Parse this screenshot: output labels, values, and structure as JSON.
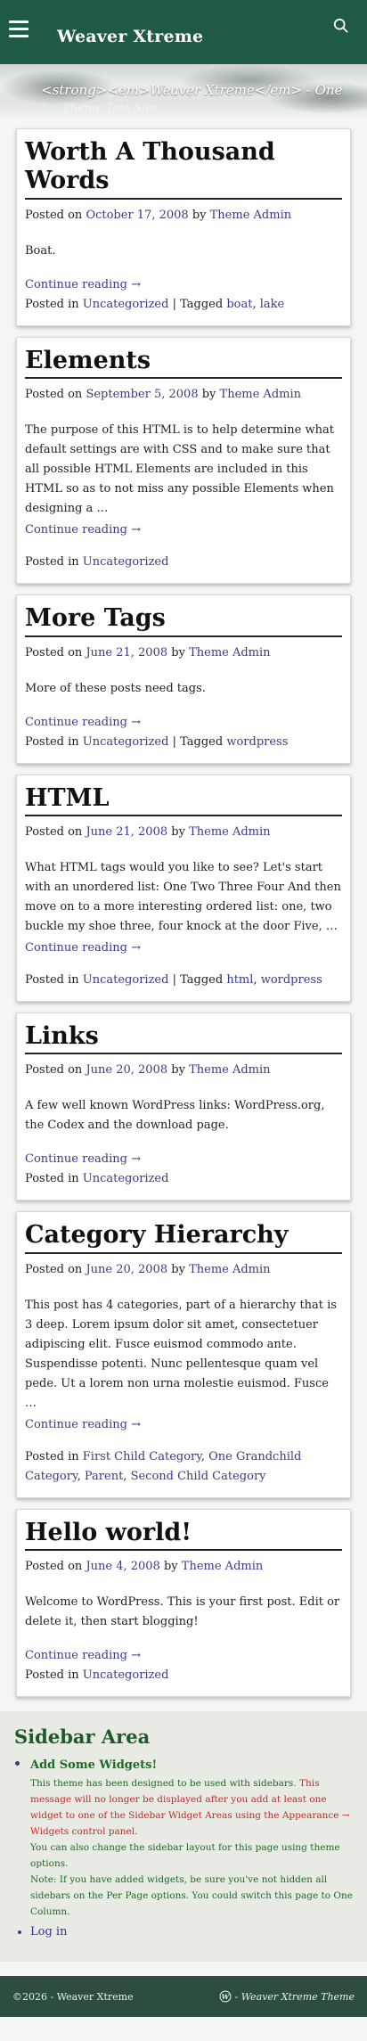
{
  "header": {
    "site_title": "Weaver Xtreme",
    "tagline": "<strong><em>Weaver Xtreme</em> - One",
    "tagline_ghost": "Theme Test Site"
  },
  "posts": [
    {
      "title": "Worth A Thousand Words",
      "posted_on": "Posted on",
      "date": "October 17, 2008",
      "by": "by",
      "author": "Theme Admin",
      "excerpt": "Boat.",
      "more": "Continue reading →",
      "posted_in": "Posted in",
      "categories": [
        "Uncategorized"
      ],
      "tagged": "Tagged",
      "tags": [
        "boat",
        "lake"
      ]
    },
    {
      "title": "Elements",
      "posted_on": "Posted on",
      "date": "September 5, 2008",
      "by": "by",
      "author": "Theme Admin",
      "excerpt": "The purpose of this HTML is to help determine what default settings are with CSS and to make sure that all possible HTML Elements are included in this HTML so as to not miss any possible Elements when designing a …",
      "more": "Continue reading →",
      "posted_in": "Posted in",
      "categories": [
        "Uncategorized"
      ],
      "tagged": "",
      "tags": []
    },
    {
      "title": "More Tags",
      "posted_on": "Posted on",
      "date": "June 21, 2008",
      "by": "by",
      "author": "Theme Admin",
      "excerpt": "More of these posts need tags.",
      "more": "Continue reading →",
      "posted_in": "Posted in",
      "categories": [
        "Uncategorized"
      ],
      "tagged": "Tagged",
      "tags": [
        "wordpress"
      ]
    },
    {
      "title": "HTML",
      "posted_on": "Posted on",
      "date": "June 21, 2008",
      "by": "by",
      "author": "Theme Admin",
      "excerpt": "What HTML tags would you like to see? Let's start with an unordered list: One Two Three Four And then move on to a more interesting ordered list: one, two buckle my shoe three, four knock at the door Five, …",
      "more": "Continue reading →",
      "posted_in": "Posted in",
      "categories": [
        "Uncategorized"
      ],
      "tagged": "Tagged",
      "tags": [
        "html",
        "wordpress"
      ]
    },
    {
      "title": "Links",
      "posted_on": "Posted on",
      "date": "June 20, 2008",
      "by": "by",
      "author": "Theme Admin",
      "excerpt": "A few well known WordPress links: WordPress.org, the Codex and the download page.",
      "more": "Continue reading →",
      "posted_in": "Posted in",
      "categories": [
        "Uncategorized"
      ],
      "tagged": "",
      "tags": []
    },
    {
      "title": "Category Hierarchy",
      "posted_on": "Posted on",
      "date": "June 20, 2008",
      "by": "by",
      "author": "Theme Admin",
      "excerpt": "This post has 4 categories, part of a hierarchy that is 3 deep. Lorem ipsum dolor sit amet, consectetuer adipiscing elit. Fusce euismod commodo ante. Suspendisse potenti. Nunc pellentesque quam vel pede. Ut a lorem non urna molestie euismod. Fusce …",
      "more": "Continue reading →",
      "posted_in": "Posted in",
      "categories": [
        "First Child Category",
        "One Grandchild Category",
        "Parent",
        "Second Child Category"
      ],
      "tagged": "",
      "tags": []
    },
    {
      "title": "Hello world!",
      "posted_on": "Posted on",
      "date": "June 4, 2008",
      "by": "by",
      "author": "Theme Admin",
      "excerpt": "Welcome to WordPress. This is your first post. Edit or delete it, then start blogging!",
      "more": "Continue reading →",
      "posted_in": "Posted in",
      "categories": [
        "Uncategorized"
      ],
      "tagged": "",
      "tags": []
    }
  ],
  "sidebar": {
    "title": "Sidebar Area",
    "widget_title": "Add Some Widgets!",
    "msg1_green": "This theme has been designed to be used with sidebars.",
    "msg1_red": "This message will no longer be displayed after you add at least one widget to one of the Sidebar Widget Areas using the Appearance → Widgets control panel.",
    "msg2": "You can also change the sidebar layout for this page using theme options.",
    "msg3": "Note: If you have added widgets, be sure you've not hidden all sidebars on the Per Page options. You could switch this page to One Column.",
    "login": "Log in"
  },
  "footer": {
    "copyright": "©2026 - Weaver Xtreme",
    "credit": "- Weaver Xtreme Theme"
  },
  "colors": {
    "header_bg": "#1e5a44",
    "link": "#3a3a8c",
    "sidebar_green": "#1d6b23",
    "sidebar_red": "#c62828",
    "footer_bg": "#2d4d3e"
  }
}
